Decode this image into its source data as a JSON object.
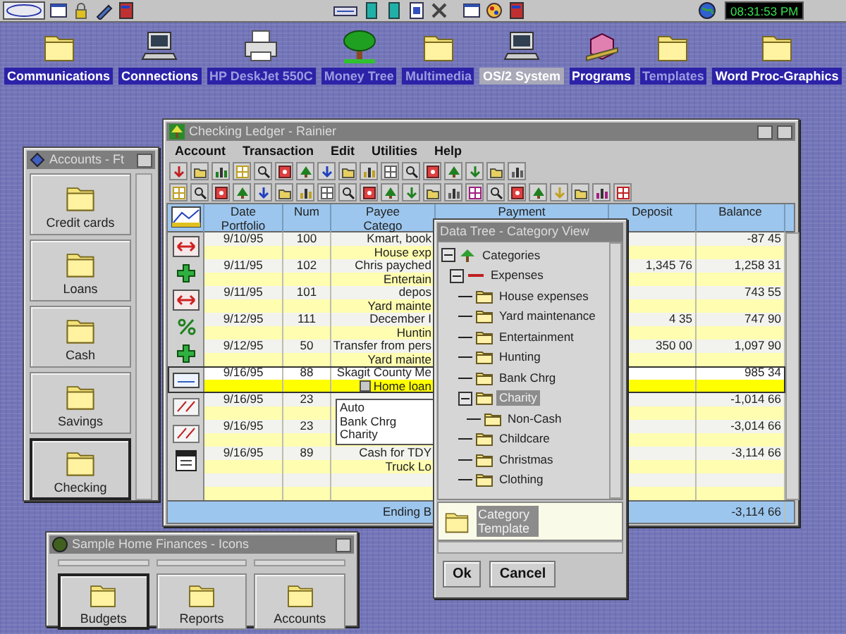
{
  "taskbar": {
    "clock": "08:31:53 PM"
  },
  "desktop_icons": [
    {
      "label": "Communications",
      "selected": false,
      "dimmed": false
    },
    {
      "label": "Connections",
      "selected": false,
      "dimmed": false
    },
    {
      "label": "HP DeskJet 550C",
      "selected": false,
      "dimmed": true
    },
    {
      "label": "Money Tree",
      "selected": false,
      "dimmed": true
    },
    {
      "label": "Multimedia",
      "selected": false,
      "dimmed": true
    },
    {
      "label": "OS/2 System",
      "selected": true,
      "dimmed": false
    },
    {
      "label": "Programs",
      "selected": false,
      "dimmed": false
    },
    {
      "label": "Templates",
      "selected": false,
      "dimmed": true
    },
    {
      "label": "Word Proc-Graphics",
      "selected": false,
      "dimmed": false
    }
  ],
  "accounts_window": {
    "title": "Accounts - Ft",
    "buttons": [
      {
        "label": "Credit cards",
        "selected": false
      },
      {
        "label": "Loans",
        "selected": false
      },
      {
        "label": "Cash",
        "selected": false
      },
      {
        "label": "Savings",
        "selected": false
      },
      {
        "label": "Checking",
        "selected": true
      }
    ]
  },
  "ledger": {
    "title": "Checking Ledger - Rainier",
    "menu": [
      "Account",
      "Transaction",
      "Edit",
      "Utilities",
      "Help"
    ],
    "columns": [
      {
        "label": "Date",
        "sublabel": "Portfolio"
      },
      {
        "label": "Num"
      },
      {
        "label": "Payee",
        "sublabel": "Catego"
      },
      {
        "label": "Payment"
      },
      {
        "label": "Deposit"
      },
      {
        "label": "Balance"
      }
    ],
    "rows": [
      {
        "kind": "withdrawal",
        "date": "9/10/95",
        "num": "100",
        "payee": "Kmart, book",
        "category": "House exp",
        "balance": "-87 45",
        "selected": false
      },
      {
        "kind": "deposit",
        "date": "9/11/95",
        "num": "102",
        "payee": "Chris payched",
        "category": "Entertain",
        "deposit": "1,345 76",
        "balance": "1,258 31",
        "selected": false
      },
      {
        "kind": "withdrawal",
        "date": "9/11/95",
        "num": "101",
        "payee": "depos",
        "category": "Yard mainte",
        "balance": "743 55",
        "selected": false
      },
      {
        "kind": "interest",
        "date": "9/12/95",
        "num": "111",
        "payee": "December I",
        "category": "Huntin",
        "deposit": "4 35",
        "balance": "747 90",
        "selected": false
      },
      {
        "kind": "deposit",
        "date": "9/12/95",
        "num": "50",
        "payee": "Transfer from pers",
        "category": "Yard mainte",
        "deposit": "350 00",
        "balance": "1,097 90",
        "selected": false
      },
      {
        "kind": "check",
        "date": "9/16/95",
        "num": "88",
        "payee": "Skagit County Me",
        "category": "Home loan",
        "balance": "985 34",
        "selected": true
      },
      {
        "kind": "fee",
        "date": "9/16/95",
        "num": "23",
        "balance": "-1,014 66",
        "selected": false
      },
      {
        "kind": "fee",
        "date": "9/16/95",
        "num": "23",
        "balance": "-3,014 66",
        "selected": false
      },
      {
        "kind": "scheduled",
        "date": "9/16/95",
        "num": "89",
        "payee": "Cash for TDY",
        "category": "Truck Lo",
        "balance": "-3,114 66",
        "selected": false
      },
      {
        "kind": "empty",
        "selected": false
      }
    ],
    "category_list": [
      "Auto",
      "Bank Chrg",
      "Charity"
    ],
    "ending": {
      "label": "Ending B",
      "balance": "-3,114 66"
    }
  },
  "category_window": {
    "title": "Data Tree - Category View",
    "tree": [
      {
        "label": "Categories",
        "expanded": true,
        "selected": false,
        "children": [
          {
            "label": "Expenses",
            "expanded": true,
            "selected": false,
            "children": [
              {
                "label": "House expenses",
                "selected": false
              },
              {
                "label": "Yard maintenance",
                "selected": false
              },
              {
                "label": "Entertainment",
                "selected": false
              },
              {
                "label": "Hunting",
                "selected": false
              },
              {
                "label": "Bank Chrg",
                "selected": false
              },
              {
                "label": "Charity",
                "expanded": true,
                "selected": true,
                "children": [
                  {
                    "label": "Non-Cash",
                    "selected": false
                  }
                ]
              },
              {
                "label": "Childcare",
                "selected": false
              },
              {
                "label": "Christmas",
                "selected": false
              },
              {
                "label": "Clothing",
                "selected": false
              }
            ]
          }
        ]
      }
    ],
    "template": {
      "label": "Category Template",
      "selected": true
    },
    "buttons": [
      "Ok",
      "Cancel"
    ]
  },
  "sample_window": {
    "title": "Sample Home Finances - Icons",
    "buttons": [
      {
        "label": "Budgets",
        "selected": true
      },
      {
        "label": "Reports",
        "selected": false
      },
      {
        "label": "Accounts",
        "selected": false
      }
    ]
  }
}
